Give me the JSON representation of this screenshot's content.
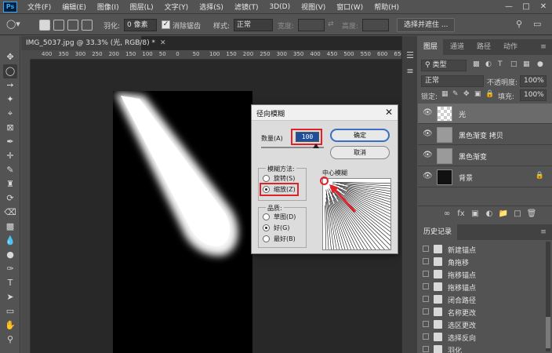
{
  "app": {
    "logo_text": "Ps"
  },
  "menu": [
    "文件(F)",
    "编辑(E)",
    "图像(I)",
    "图层(L)",
    "文字(Y)",
    "选择(S)",
    "滤镜(T)",
    "3D(D)",
    "视图(V)",
    "窗口(W)",
    "帮助(H)"
  ],
  "options_bar": {
    "feather_label": "羽化:",
    "feather_value": "0 像素",
    "antialias_label": "消除锯齿",
    "style_label": "样式:",
    "style_value": "正常",
    "width_label": "宽度:",
    "height_label": "高度:",
    "select_mask_button": "选择并遮住 ..."
  },
  "document": {
    "tab_title": "IMG_5037.jpg @ 33.3% (光, RGB/8) *",
    "ruler_ticks": [
      "400",
      "350",
      "300",
      "250",
      "200",
      "150",
      "100",
      "50",
      "0",
      "50",
      "100",
      "150",
      "200",
      "250",
      "300",
      "350",
      "400",
      "450",
      "500",
      "550",
      "600",
      "650",
      "700"
    ]
  },
  "dialog": {
    "title": "径向模糊",
    "amount_label": "数量(A)",
    "amount_value": "100",
    "ok_button": "确定",
    "cancel_button": "取消",
    "method_label": "模糊方法:",
    "method_spin": "旋转(S)",
    "method_zoom": "缩放(Z)",
    "quality_label": "品质:",
    "quality_draft": "草图(D)",
    "quality_good": "好(G)",
    "quality_best": "最好(B)",
    "center_label": "中心模糊",
    "highlight_color": "#e0222b"
  },
  "layers_panel": {
    "tabs": [
      "图层",
      "通道",
      "路径",
      "动作"
    ],
    "kind_filter": "类型",
    "blend_mode": "正常",
    "opacity_label": "不透明度:",
    "opacity_value": "100%",
    "lock_label": "锁定:",
    "fill_label": "填充:",
    "fill_value": "100%",
    "layers": [
      {
        "name": "光",
        "selected": true,
        "thumb": "checker"
      },
      {
        "name": "黑色渐变 拷贝",
        "selected": false,
        "thumb": "gray"
      },
      {
        "name": "黑色渐变",
        "selected": false,
        "thumb": "gray"
      },
      {
        "name": "背景",
        "selected": false,
        "thumb": "dark",
        "locked": true
      }
    ]
  },
  "history_panel": {
    "title": "历史记录",
    "items": [
      "新建锚点",
      "角拖移",
      "拖移锚点",
      "拖移锚点",
      "闭合路径",
      "名称更改",
      "选区更改",
      "选择反向",
      "羽化"
    ]
  }
}
